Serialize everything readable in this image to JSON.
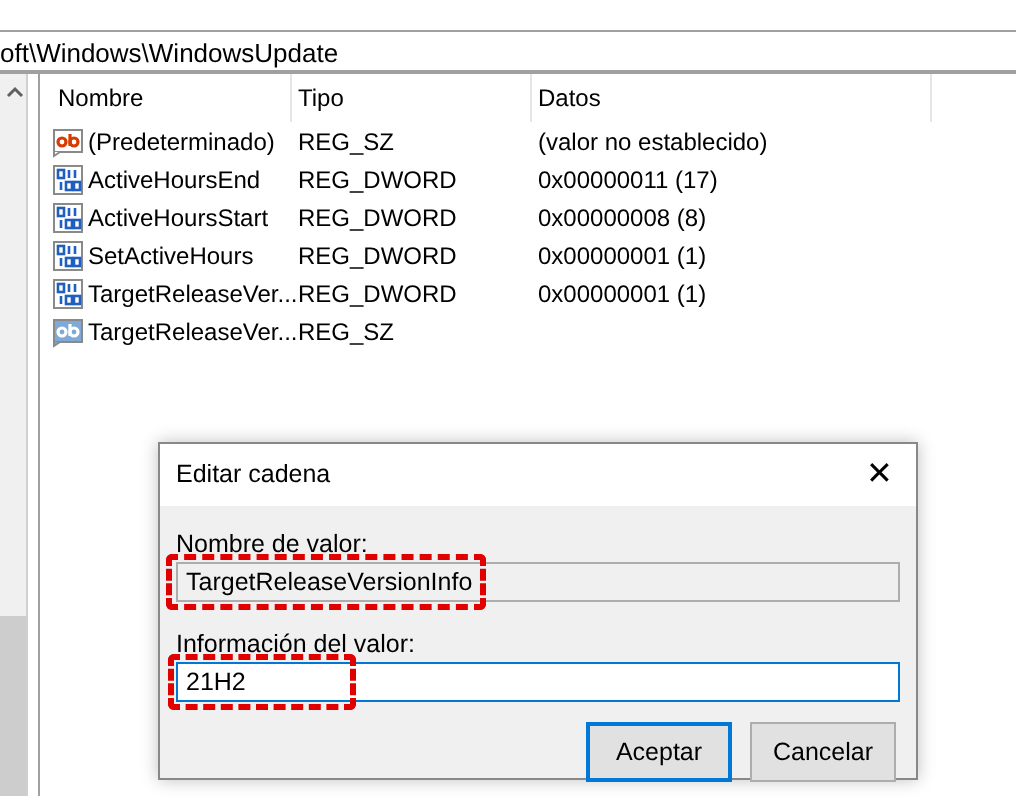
{
  "address_bar": {
    "path": "oft\\Windows\\WindowsUpdate"
  },
  "table": {
    "columns": [
      "Nombre",
      "Tipo",
      "Datos"
    ],
    "rows": [
      {
        "kind": "string",
        "selected": false,
        "cells": [
          "(Predeterminado)",
          "REG_SZ",
          "(valor no establecido)"
        ]
      },
      {
        "kind": "binary",
        "selected": false,
        "cells": [
          "ActiveHoursEnd",
          "REG_DWORD",
          "0x00000011 (17)"
        ]
      },
      {
        "kind": "binary",
        "selected": false,
        "cells": [
          "ActiveHoursStart",
          "REG_DWORD",
          "0x00000008 (8)"
        ]
      },
      {
        "kind": "binary",
        "selected": false,
        "cells": [
          "SetActiveHours",
          "REG_DWORD",
          "0x00000001 (1)"
        ]
      },
      {
        "kind": "binary",
        "selected": false,
        "cells": [
          "TargetReleaseVer...",
          "REG_DWORD",
          "0x00000001 (1)"
        ]
      },
      {
        "kind": "string",
        "selected": true,
        "cells": [
          "TargetReleaseVer...",
          "REG_SZ"
        ]
      }
    ]
  },
  "dialog": {
    "title": "Editar cadena",
    "close": "✕",
    "fields": [
      {
        "label": "Nombre de valor:",
        "value": "TargetReleaseVersionInfo",
        "disabled": true,
        "highlighted": true
      },
      {
        "label": "Información del valor:",
        "value": "21H2",
        "disabled": false,
        "highlighted": true
      }
    ],
    "buttons": [
      {
        "label": "Aceptar",
        "default": true
      },
      {
        "label": "Cancelar",
        "default": false
      }
    ]
  }
}
